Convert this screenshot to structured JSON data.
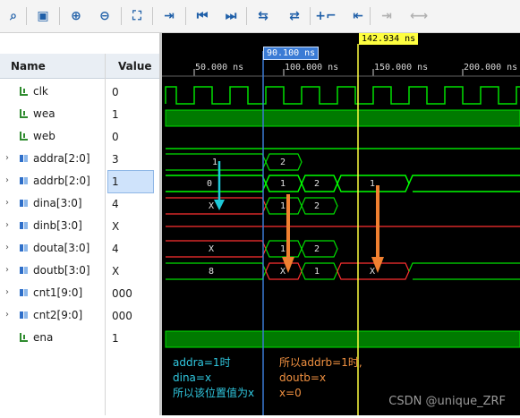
{
  "toolbar": {
    "buttons": [
      {
        "icon": "search-icon",
        "glyph": "⌕",
        "enabled": true
      },
      {
        "icon": "save-icon",
        "glyph": "▣",
        "enabled": true
      },
      {
        "icon": "zoom-in-icon",
        "glyph": "⊕",
        "enabled": true
      },
      {
        "icon": "zoom-out-icon",
        "glyph": "⊖",
        "enabled": true
      },
      {
        "icon": "zoom-fit-icon",
        "glyph": "⛶",
        "enabled": true
      },
      {
        "icon": "go-to-cursor-icon",
        "glyph": "⇥",
        "enabled": true
      },
      {
        "icon": "go-to-start-icon",
        "glyph": "⏮",
        "enabled": true
      },
      {
        "icon": "go-to-end-icon",
        "glyph": "⏭",
        "enabled": true
      },
      {
        "icon": "previous-transition-icon",
        "glyph": "⇆",
        "enabled": true
      },
      {
        "icon": "next-transition-icon",
        "glyph": "⇄",
        "enabled": true
      },
      {
        "icon": "add-marker-icon",
        "glyph": "+⌐",
        "enabled": true
      },
      {
        "icon": "previous-marker-icon",
        "glyph": "⇤",
        "enabled": true
      },
      {
        "icon": "next-marker-icon",
        "glyph": "⇥",
        "enabled": false
      },
      {
        "icon": "swap-cursors-icon",
        "glyph": "⟷",
        "enabled": false
      }
    ]
  },
  "columns": {
    "name": "Name",
    "value": "Value"
  },
  "signals": [
    {
      "name": "clk",
      "value": "0",
      "bus": false
    },
    {
      "name": "wea",
      "value": "1",
      "bus": false
    },
    {
      "name": "web",
      "value": "0",
      "bus": false
    },
    {
      "name": "addra[2:0]",
      "value": "3",
      "bus": true
    },
    {
      "name": "addrb[2:0]",
      "value": "1",
      "bus": true,
      "selected": true
    },
    {
      "name": "dina[3:0]",
      "value": "4",
      "bus": true
    },
    {
      "name": "dinb[3:0]",
      "value": "X",
      "bus": true
    },
    {
      "name": "douta[3:0]",
      "value": "4",
      "bus": true
    },
    {
      "name": "doutb[3:0]",
      "value": "X",
      "bus": true
    },
    {
      "name": "cnt1[9:0]",
      "value": "000",
      "bus": true
    },
    {
      "name": "cnt2[9:0]",
      "value": "000",
      "bus": true
    },
    {
      "name": "ena",
      "value": "1",
      "bus": false
    }
  ],
  "timeline": {
    "ticks": [
      "50.000 ns",
      "100.000 ns",
      "150.000 ns",
      "200.000 ns"
    ],
    "cursor_blue": "90.100 ns",
    "cursor_yellow": "142.934 ns"
  },
  "wave_labels": {
    "addra": [
      "1",
      "2"
    ],
    "addrb": [
      "0",
      "1",
      "2",
      "1"
    ],
    "dina": [
      "X",
      "1",
      "2"
    ],
    "douta": [
      "X",
      "1",
      "2"
    ],
    "doutb": [
      "8",
      "X",
      "1",
      "X"
    ]
  },
  "annotations": {
    "left": [
      "addra=1时",
      "dina=x",
      "所以该位置值为x"
    ],
    "right": [
      "所以addrb=1时,",
      "doutb=x",
      "x=0"
    ]
  },
  "watermark": "CSDN @unique_ZRF",
  "colors": {
    "wave_green": "#00e000",
    "wave_red": "#ff3030",
    "cursor_blue": "#3a7bd5",
    "cursor_yellow": "#ffff40",
    "arrow_cyan": "#1ec8d8",
    "arrow_orange": "#f08030",
    "ann_cyan": "#30c8e0",
    "ann_orange": "#f09040"
  }
}
